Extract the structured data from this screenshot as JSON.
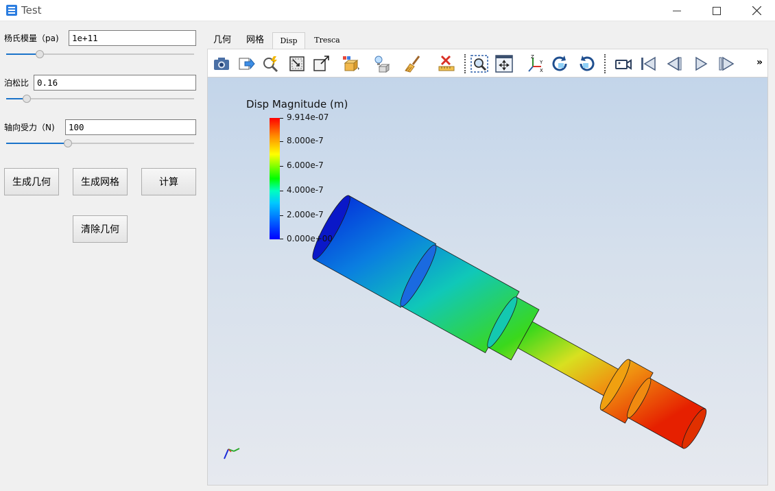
{
  "window": {
    "title": "Test"
  },
  "params": {
    "youngs_label": "杨氏模量（pa)",
    "youngs_value": "1e+11",
    "youngs_slider": 0.18,
    "poisson_label": "泊松比",
    "poisson_value": "0.16",
    "poisson_slider": 0.11,
    "force_label": "轴向受力（N)",
    "force_value": "100",
    "force_slider": 0.33
  },
  "buttons": {
    "generate_geometry": "生成几何",
    "generate_mesh": "生成网格",
    "compute": "计算",
    "clear_geometry": "清除几何"
  },
  "tabs": [
    "几何",
    "网格",
    "Disp",
    "Tresca"
  ],
  "active_tab": "Disp",
  "toolbar_icons": [
    "camera-icon",
    "export-icon",
    "probe-icon",
    "select-cells-icon",
    "select-points-icon",
    "select-block-icon",
    "light-icon",
    "brush-icon",
    "clear-selection-icon",
    "zoom-to-box-icon",
    "reset-camera-icon",
    "axes-icon",
    "rotate-cw-icon",
    "rotate-ccw-icon",
    "camera-record-icon",
    "first-frame-icon",
    "previous-frame-icon",
    "play-icon",
    "last-frame-icon"
  ],
  "legend": {
    "title": "Disp Magnitude (m)",
    "ticks": [
      "9.914e-07",
      "8.000e-7",
      "6.000e-7",
      "4.000e-7",
      "2.000e-7",
      "0.000e+00"
    ],
    "colors": [
      "#ff0000",
      "#ffff00",
      "#00ff00",
      "#00ffff",
      "#0000ff"
    ]
  },
  "more_glyph": "»"
}
